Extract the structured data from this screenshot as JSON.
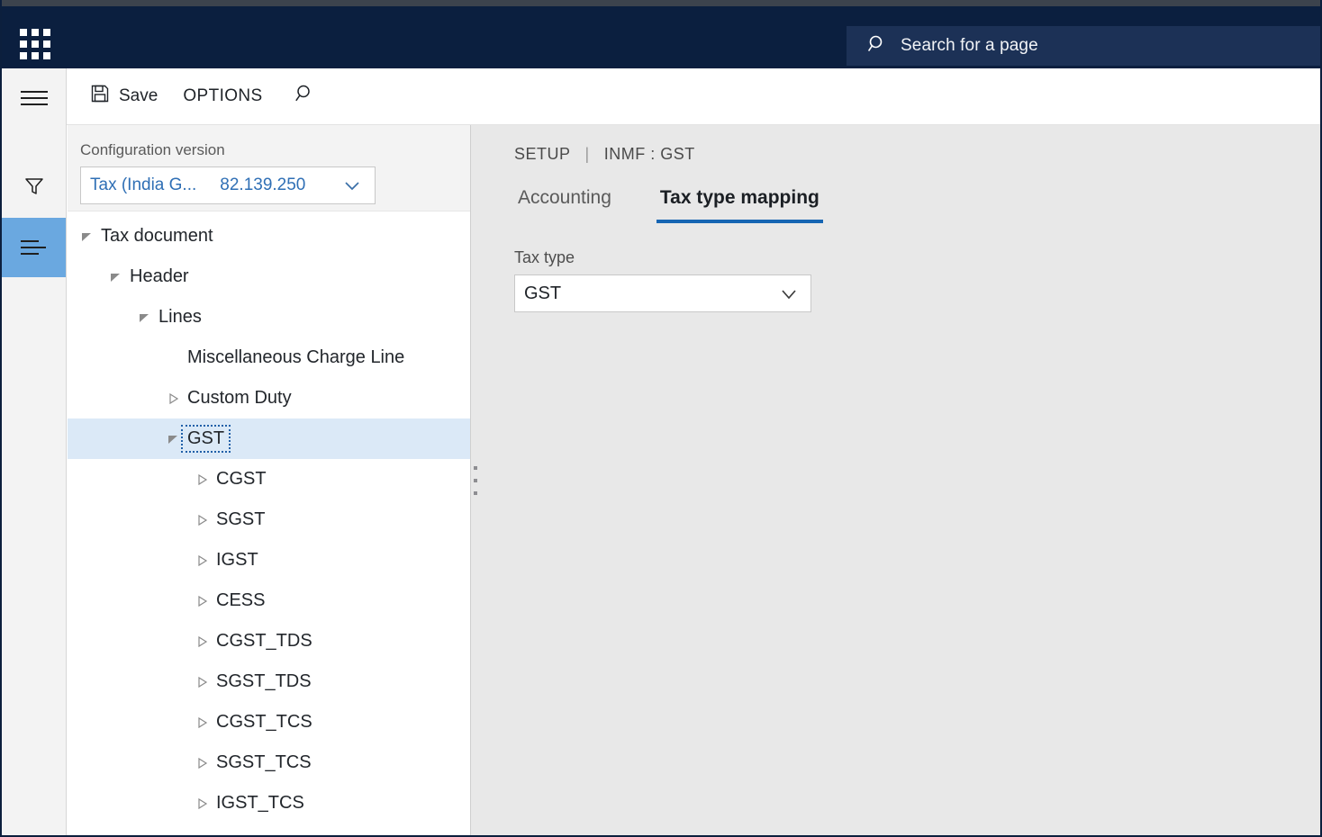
{
  "topbar": {
    "waffle_icon": "app-grid-icon",
    "search": {
      "icon": "search-icon",
      "placeholder": "Search for a page"
    }
  },
  "rail": {
    "items": [
      {
        "icon": "hamburger-menu-icon",
        "name": "navigation-menu",
        "selected": false
      },
      {
        "icon": "filter-funnel-icon",
        "name": "filter",
        "selected": false
      },
      {
        "icon": "outline-list-icon",
        "name": "outline",
        "selected": true
      }
    ]
  },
  "commandbar": {
    "save_icon": "save-floppy-icon",
    "save_label": "Save",
    "options_label": "OPTIONS",
    "search_icon": "search-icon"
  },
  "left_panel": {
    "config_version": {
      "label": "Configuration version",
      "name": "Tax (India G...",
      "version": "82.139.250",
      "chevron_icon": "chevron-down-icon"
    },
    "tree": [
      {
        "label": "Tax document",
        "indent": 0,
        "twisty": "expanded",
        "selected": false,
        "focused": false
      },
      {
        "label": "Header",
        "indent": 1,
        "twisty": "expanded",
        "selected": false,
        "focused": false
      },
      {
        "label": "Lines",
        "indent": 2,
        "twisty": "expanded",
        "selected": false,
        "focused": false
      },
      {
        "label": "Miscellaneous Charge Line",
        "indent": 3,
        "twisty": "none",
        "selected": false,
        "focused": false
      },
      {
        "label": "Custom Duty",
        "indent": 3,
        "twisty": "collapsed",
        "selected": false,
        "focused": false
      },
      {
        "label": "GST",
        "indent": 3,
        "twisty": "expanded",
        "selected": true,
        "focused": true
      },
      {
        "label": "CGST",
        "indent": 4,
        "twisty": "collapsed",
        "selected": false,
        "focused": false
      },
      {
        "label": "SGST",
        "indent": 4,
        "twisty": "collapsed",
        "selected": false,
        "focused": false
      },
      {
        "label": "IGST",
        "indent": 4,
        "twisty": "collapsed",
        "selected": false,
        "focused": false
      },
      {
        "label": "CESS",
        "indent": 4,
        "twisty": "collapsed",
        "selected": false,
        "focused": false
      },
      {
        "label": "CGST_TDS",
        "indent": 4,
        "twisty": "collapsed",
        "selected": false,
        "focused": false
      },
      {
        "label": "SGST_TDS",
        "indent": 4,
        "twisty": "collapsed",
        "selected": false,
        "focused": false
      },
      {
        "label": "CGST_TCS",
        "indent": 4,
        "twisty": "collapsed",
        "selected": false,
        "focused": false
      },
      {
        "label": "SGST_TCS",
        "indent": 4,
        "twisty": "collapsed",
        "selected": false,
        "focused": false
      },
      {
        "label": "IGST_TCS",
        "indent": 4,
        "twisty": "collapsed",
        "selected": false,
        "focused": false
      }
    ]
  },
  "splitter": {
    "icon": "splitter-dots-icon"
  },
  "right_panel": {
    "breadcrumb": {
      "root": "SETUP",
      "separator": "|",
      "current": "INMF : GST"
    },
    "tabs": [
      {
        "label": "Accounting",
        "active": false
      },
      {
        "label": "Tax type mapping",
        "active": true
      }
    ],
    "tax_type": {
      "label": "Tax type",
      "value": "GST",
      "chevron_icon": "chevron-down-icon"
    }
  },
  "colors": {
    "navy": "#0b1f3f",
    "search_field": "#1c3156",
    "rail_selected": "#6aa8e0",
    "tree_selected": "#dbe9f7",
    "focus_outline": "#1f5fa8",
    "tab_underline": "#1665b3",
    "link_blue": "#2f6fb5",
    "panel_bg": "#e8e8e8"
  }
}
